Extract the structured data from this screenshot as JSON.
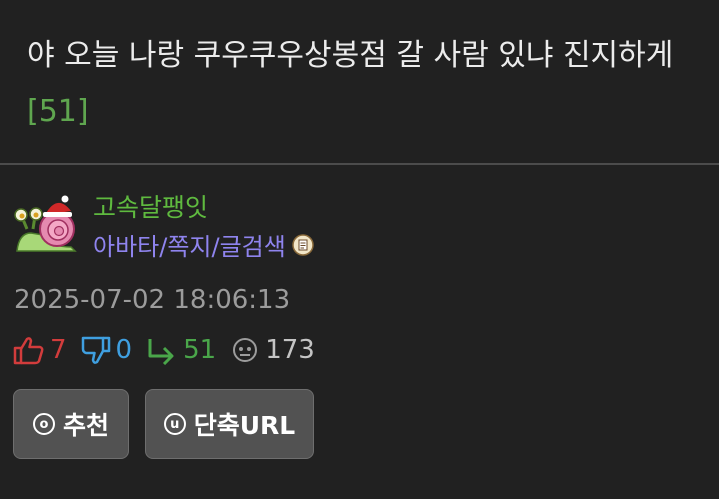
{
  "post": {
    "title": "야 오늘 나랑 쿠우쿠우상봉점 갈 사람 있냐 진지하게",
    "comment_count": "[51]"
  },
  "author": {
    "nickname": "고속달팽잇",
    "links": "아바타/쪽지/글검색"
  },
  "timestamp": "2025-07-02 18:06:13",
  "stats": {
    "upvotes": "7",
    "downvotes": "0",
    "replies": "51",
    "views": "173"
  },
  "buttons": {
    "recommend_label": "추천",
    "recommend_glyph": "o",
    "shorturl_label": "단축URL",
    "shorturl_glyph": "u"
  },
  "colors": {
    "background": "#212121",
    "title_text": "#ececec",
    "comment_count": "#5fa64f",
    "nickname": "#5fba3f",
    "links": "#8f84ee",
    "upvote": "#d23c3c",
    "downvote": "#3f9fe0",
    "reply": "#4aa64a",
    "button_bg": "#525252"
  }
}
